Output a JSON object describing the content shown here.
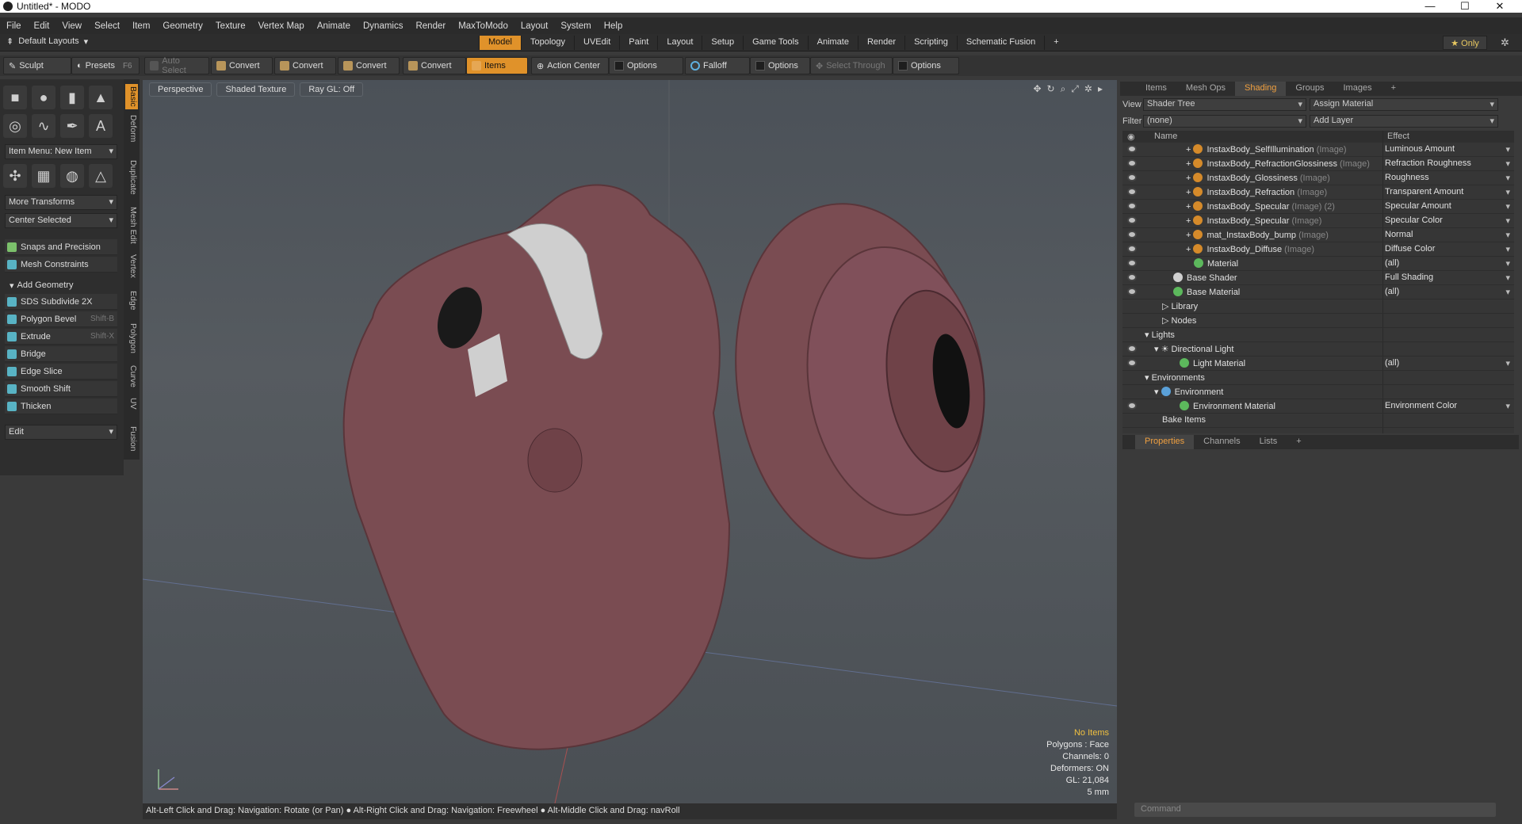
{
  "window": {
    "title": "Untitled* - MODO"
  },
  "menu": [
    "File",
    "Edit",
    "View",
    "Select",
    "Item",
    "Geometry",
    "Texture",
    "Vertex Map",
    "Animate",
    "Dynamics",
    "Render",
    "MaxToModo",
    "Layout",
    "System",
    "Help"
  ],
  "layouts": {
    "label": "Default Layouts",
    "tabs": [
      "Model",
      "Topology",
      "UVEdit",
      "Paint",
      "Layout",
      "Setup",
      "Game Tools",
      "Animate",
      "Render",
      "Scripting",
      "Schematic Fusion"
    ],
    "active": "Model",
    "only": "Only"
  },
  "toolbar": {
    "sculpt": "Sculpt",
    "presets": "Presets",
    "presets_key": "F6",
    "auto_select": "Auto Select",
    "convert": "Convert",
    "items": "Items",
    "action_center": "Action Center",
    "options": "Options",
    "falloff": "Falloff",
    "select_through": "Select Through"
  },
  "left": {
    "item_menu": "Item Menu: New Item",
    "more_transforms": "More Transforms",
    "center_selected": "Center Selected",
    "snaps": "Snaps and Precision",
    "mesh_constraints": "Mesh Constraints",
    "add_geometry": "Add Geometry",
    "tools": [
      {
        "label": "SDS Subdivide 2X",
        "key": ""
      },
      {
        "label": "Polygon Bevel",
        "key": "Shift-B"
      },
      {
        "label": "Extrude",
        "key": "Shift-X"
      },
      {
        "label": "Bridge",
        "key": ""
      },
      {
        "label": "Edge Slice",
        "key": ""
      },
      {
        "label": "Smooth Shift",
        "key": ""
      },
      {
        "label": "Thicken",
        "key": ""
      }
    ],
    "edit": "Edit",
    "vtabs": [
      "Basic",
      "Deform",
      "Duplicate",
      "Mesh Edit",
      "Vertex",
      "Edge",
      "Polygon",
      "Curve",
      "UV",
      "Fusion"
    ]
  },
  "viewport": {
    "view": "Perspective",
    "shading": "Shaded Texture",
    "raygl": "Ray GL: Off",
    "hud": [
      "No Items",
      "Polygons : Face",
      "Channels: 0",
      "Deformers: ON",
      "GL: 21,084",
      "5 mm"
    ]
  },
  "status": "Alt-Left Click and Drag: Navigation: Rotate (or Pan) ● Alt-Right Click and Drag: Navigation: Freewheel ● Alt-Middle Click and Drag: navRoll",
  "right": {
    "tabs": [
      "Items",
      "Mesh Ops",
      "Shading",
      "Groups",
      "Images"
    ],
    "active_tab": "Shading",
    "view_label": "View",
    "view_value": "Shader Tree",
    "assign": "Assign Material",
    "filter_label": "Filter",
    "filter_value": "(none)",
    "add_layer": "Add Layer",
    "col_name": "Name",
    "col_effect": "Effect",
    "rows": [
      {
        "name": "InstaxBody_SelfIllumination",
        "tag": "(Image)",
        "effect": "Luminous Amount"
      },
      {
        "name": "InstaxBody_RefractionGlossiness",
        "tag": "(Image)",
        "effect": "Refraction Roughness"
      },
      {
        "name": "InstaxBody_Glossiness",
        "tag": "(Image)",
        "effect": "Roughness"
      },
      {
        "name": "InstaxBody_Refraction",
        "tag": "(Image)",
        "effect": "Transparent Amount"
      },
      {
        "name": "InstaxBody_Specular",
        "tag": "(Image) (2)",
        "effect": "Specular Amount"
      },
      {
        "name": "InstaxBody_Specular",
        "tag": "(Image)",
        "effect": "Specular Color"
      },
      {
        "name": "mat_InstaxBody_bump",
        "tag": "(Image)",
        "effect": "Normal"
      },
      {
        "name": "InstaxBody_Diffuse",
        "tag": "(Image)",
        "effect": "Diffuse Color"
      },
      {
        "name": "Material",
        "tag": "",
        "effect": "(all)"
      },
      {
        "name": "Base Shader",
        "tag": "",
        "effect": "Full Shading"
      },
      {
        "name": "Base Material",
        "tag": "",
        "effect": "(all)"
      },
      {
        "name": "Library",
        "tag": "",
        "effect": ""
      },
      {
        "name": "Nodes",
        "tag": "",
        "effect": ""
      },
      {
        "name": "Lights",
        "tag": "",
        "effect": ""
      },
      {
        "name": "Directional Light",
        "tag": "",
        "effect": ""
      },
      {
        "name": "Light Material",
        "tag": "",
        "effect": "(all)"
      },
      {
        "name": "Environments",
        "tag": "",
        "effect": ""
      },
      {
        "name": "Environment",
        "tag": "",
        "effect": ""
      },
      {
        "name": "Environment Material",
        "tag": "",
        "effect": "Environment Color"
      },
      {
        "name": "Bake Items",
        "tag": "",
        "effect": ""
      }
    ],
    "prop_tabs": [
      "Properties",
      "Channels",
      "Lists"
    ],
    "command_placeholder": "Command"
  },
  "colors": {
    "accent": "#e0922a",
    "model": "#7a4c52"
  }
}
